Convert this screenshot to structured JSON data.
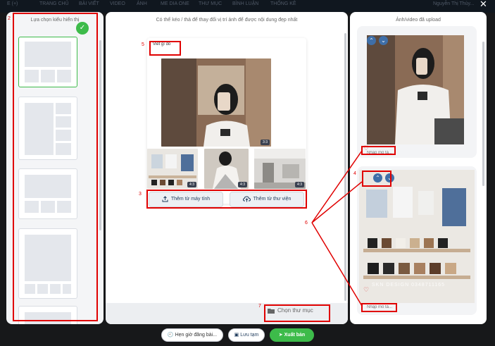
{
  "topnav": {
    "items": [
      "E (+)",
      "TRANG CHỦ",
      "BÀI VIẾT",
      "VIDEO",
      "ẢNH",
      "ME DIA ONE",
      "THƯ MỤC",
      "BÌNH LUẬN",
      "THỐNG KÊ"
    ],
    "user": "Nguyễn Thị Thùy..."
  },
  "left_panel": {
    "title": "Lựa chọn kiểu hiển thị"
  },
  "center_panel": {
    "title": "Có thể kéo / thả để thay đổi vị trí ảnh để được nội dung đẹp nhất",
    "caption": "Viết gì đó",
    "photos": [
      {
        "ratio": "3:3"
      },
      {
        "ratio": "4:3"
      },
      {
        "ratio": "4:3"
      },
      {
        "ratio": "4:3"
      }
    ],
    "upload_computer": "Thêm từ máy tính",
    "upload_library": "Thêm từ thư viện",
    "choose_folder": "Chọn thư mục"
  },
  "right_panel": {
    "title": "Ảnh/video đã upload",
    "items": [
      {
        "placeholder": "Nhập mô tả..."
      },
      {
        "placeholder": "Nhập mô tả...",
        "watermark": "SKN DESIGN 0348711165"
      }
    ]
  },
  "actions": {
    "schedule": "Hẹn giờ đăng bài...",
    "save": "Lưu tạm",
    "publish": "Xuất bản"
  },
  "annotations": [
    "2",
    "3",
    "4",
    "5",
    "6",
    "7"
  ],
  "colors": {
    "accent_green": "#3dbb4a",
    "annotation_red": "#e00000",
    "arrow_blue": "#3f6fa8"
  }
}
